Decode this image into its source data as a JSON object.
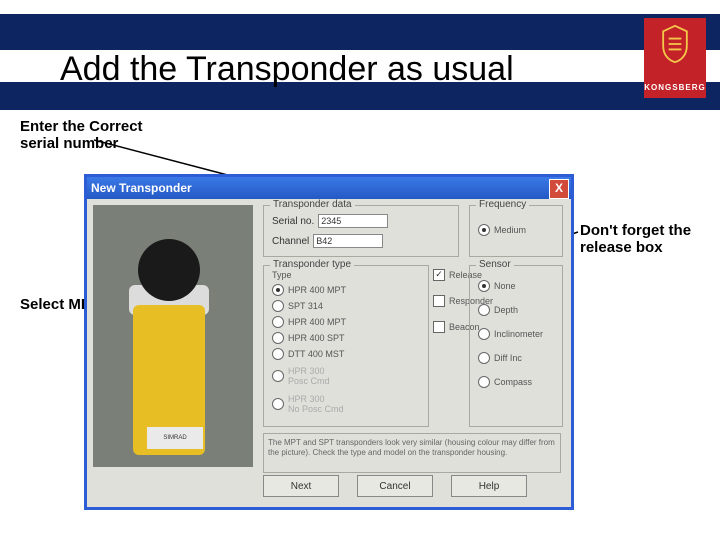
{
  "title": "Add the Transponder as usual",
  "brand": "KONGSBERG",
  "annotations": {
    "serial": "Enter the Correct serial number",
    "mpt": "Select MPT",
    "release": "Don't forget the release box"
  },
  "window": {
    "title": "New Transponder",
    "close": "X",
    "groups": {
      "td": "Transponder data",
      "freq": "Frequency",
      "tt": "Transponder type",
      "sensor": "Sensor"
    },
    "fields": {
      "serial_label": "Serial no.",
      "serial_value": "2345",
      "channel_label": "Channel",
      "channel_value": "B42"
    },
    "freq_option": "Medium",
    "type_label": "Type",
    "type_options": [
      "HPR 400 MPT",
      "SPT 314",
      "HPR 400 MPT",
      "HPR 400 SPT",
      "DTT 400 MST",
      "HPR 300\nPosc Cmd",
      "HPR 300\nNo Posc Cmd"
    ],
    "mid_options": {
      "release": "Release",
      "responder": "Responder",
      "beacon": "Beacon"
    },
    "sensor_options": [
      "None",
      "Depth",
      "Inclinometer",
      "Diff Inc",
      "Compass"
    ],
    "note": "The MPT and SPT transponders look very similar (housing colour may differ from the picture). Check the type and model on the transponder housing.",
    "buttons": {
      "next": "Next",
      "cancel": "Cancel",
      "help": "Help"
    },
    "photo_label": "SIMRAD"
  }
}
